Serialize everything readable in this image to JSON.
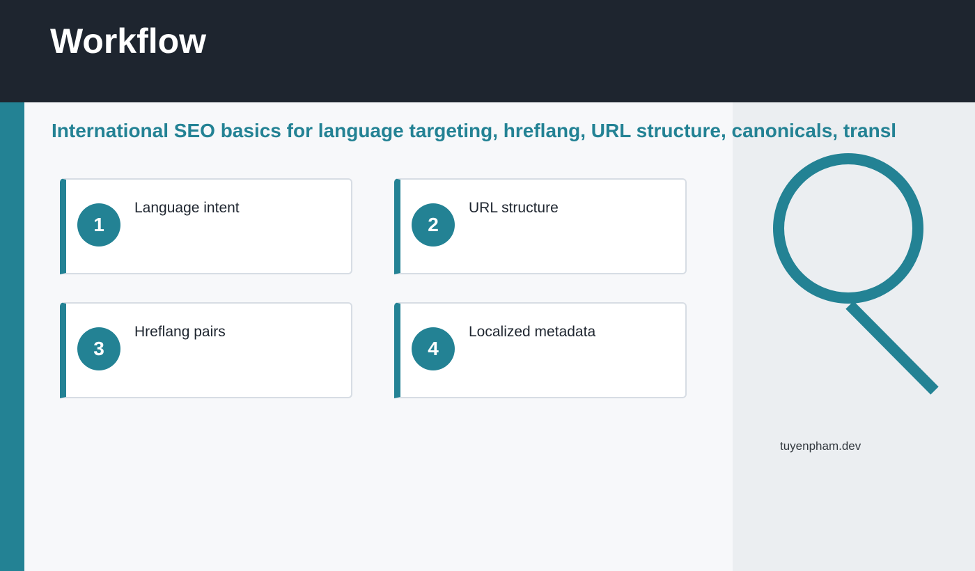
{
  "header": {
    "title": "Workflow"
  },
  "main": {
    "subtitle": "International SEO basics for language targeting, hreflang, URL structure, canonicals, transl",
    "steps": [
      {
        "number": "1",
        "label": "Language intent"
      },
      {
        "number": "2",
        "label": "URL structure"
      },
      {
        "number": "3",
        "label": "Hreflang pairs"
      },
      {
        "number": "4",
        "label": "Localized metadata"
      }
    ]
  },
  "sidebar": {
    "icon": "magnifying-glass-icon",
    "domain": "tuyenpham.dev"
  },
  "colors": {
    "accent": "#238294",
    "header_bg": "#1e252f",
    "main_bg": "#f7f8fa",
    "panel_bg": "#ebeef1",
    "card_border": "#d7dde4"
  }
}
